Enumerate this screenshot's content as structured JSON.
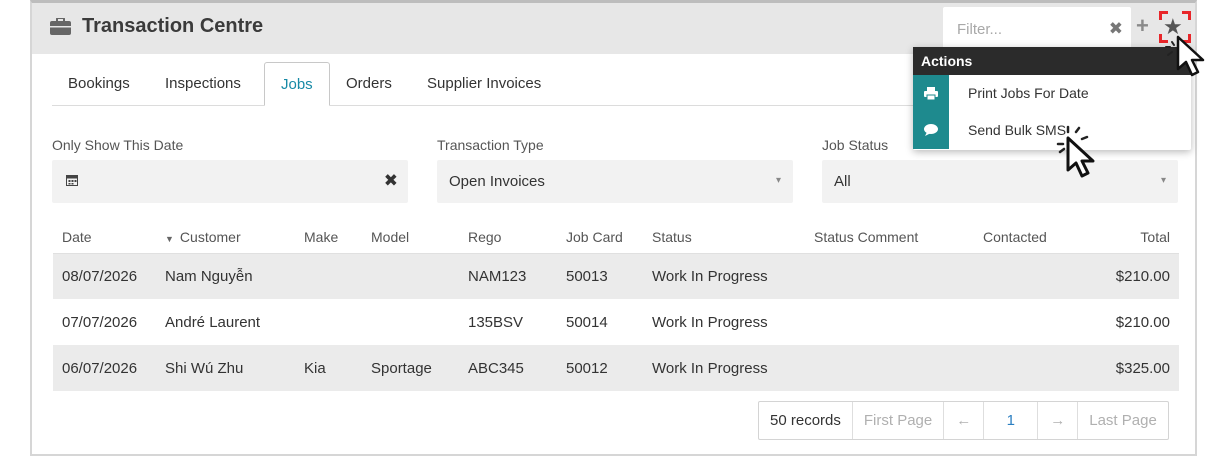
{
  "header": {
    "title": "Transaction Centre",
    "filter_placeholder": "Filter...",
    "clear": "✖",
    "add": "+",
    "star": "★"
  },
  "tabs": [
    {
      "label": "Bookings",
      "active": false
    },
    {
      "label": "Inspections",
      "active": false
    },
    {
      "label": "Jobs",
      "active": true
    },
    {
      "label": "Orders",
      "active": false
    },
    {
      "label": "Supplier Invoices",
      "active": false
    }
  ],
  "filters": {
    "date_label": "Only Show This Date",
    "date_value": "",
    "date_clear": "✖",
    "type_label": "Transaction Type",
    "type_value": "Open Invoices",
    "status_label": "Job Status",
    "status_value": "All",
    "caret": "▾"
  },
  "table": {
    "sort_icon": "▼",
    "columns": [
      "Date",
      "Customer",
      "Make",
      "Model",
      "Rego",
      "Job Card",
      "Status",
      "Status Comment",
      "Contacted",
      "Total"
    ],
    "rows": [
      [
        "08/07/2026",
        "Nam Nguyễn",
        "",
        "",
        "NAM123",
        "50013",
        "Work In Progress",
        "",
        "",
        "$210.00"
      ],
      [
        "07/07/2026",
        "André Laurent",
        "",
        "",
        "135BSV",
        "50014",
        "Work In Progress",
        "",
        "",
        "$210.00"
      ],
      [
        "06/07/2026",
        "Shi Wú Zhu",
        "Kia",
        "Sportage",
        "ABC345",
        "50012",
        "Work In Progress",
        "",
        "",
        "$325.00"
      ]
    ]
  },
  "pager": {
    "records": "50 records",
    "first": "First Page",
    "prev": "←",
    "page": "1",
    "next": "→",
    "last": "Last Page"
  },
  "actions": {
    "title": "Actions",
    "items": [
      {
        "label": "Print Jobs For Date",
        "icon": "print-icon"
      },
      {
        "label": "Send Bulk SMS",
        "icon": "chat-bubble-icon"
      }
    ]
  },
  "colors": {
    "accent": "#178aa6",
    "action_icon_bg": "#1e8a8e",
    "highlight": "#e8262a",
    "header_bg": "#e7e7e7"
  }
}
